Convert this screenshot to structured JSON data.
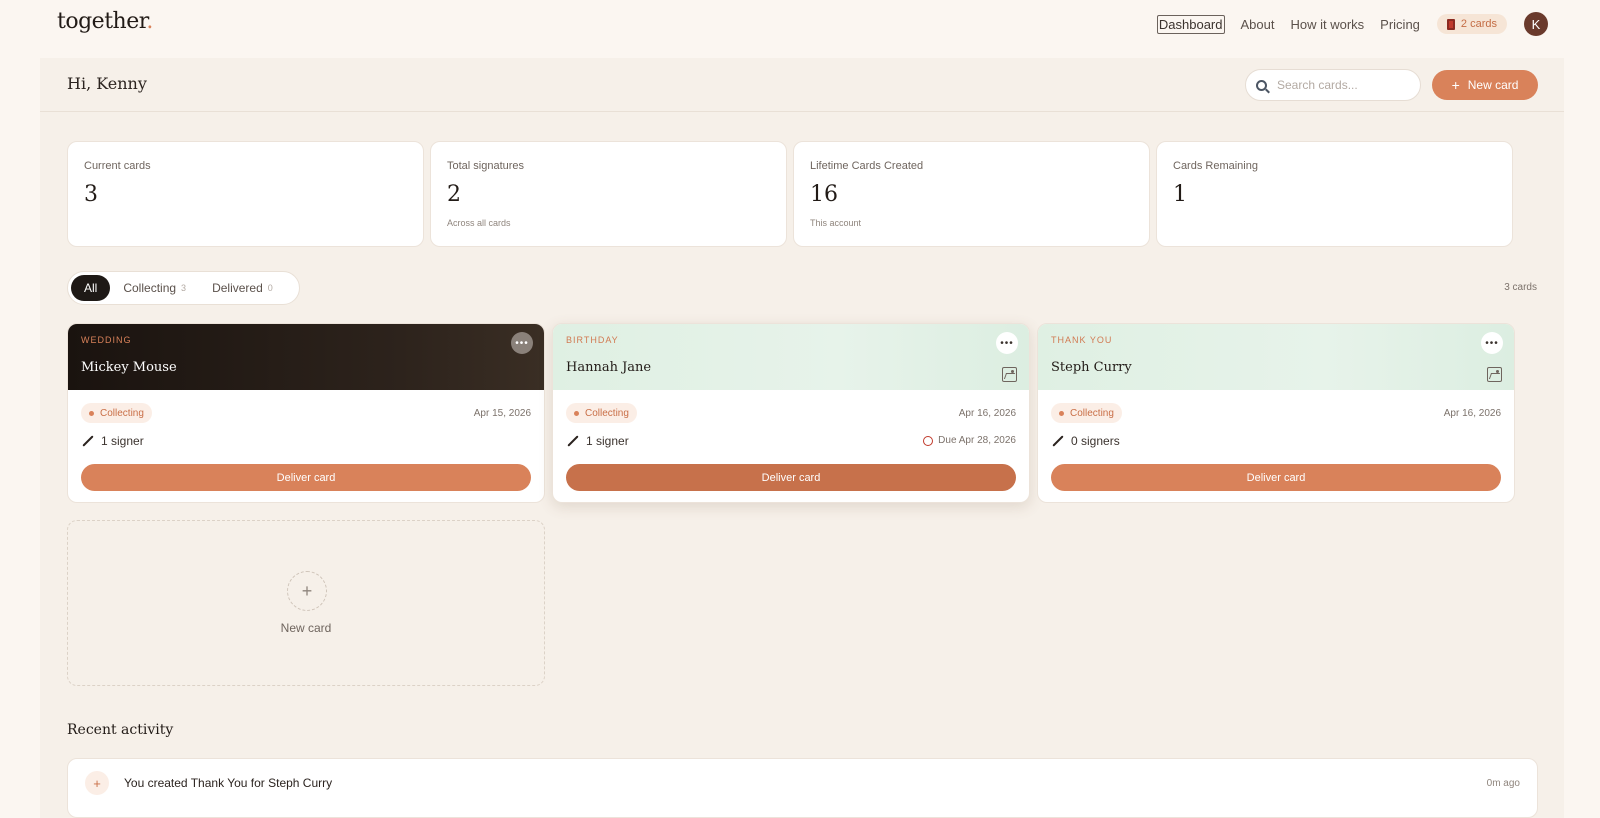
{
  "nav": {
    "logo": "together",
    "logo_dot": ".",
    "links": [
      "Dashboard",
      "About",
      "How it works",
      "Pricing"
    ],
    "credits": "2 cards",
    "avatar_initial": "K"
  },
  "header": {
    "greeting": "Hi, Kenny",
    "search_placeholder": "Search cards...",
    "new_card_label": "New card"
  },
  "stats": [
    {
      "label": "Current cards",
      "value": "3",
      "sub": ""
    },
    {
      "label": "Total signatures",
      "value": "2",
      "sub": "Across all cards"
    },
    {
      "label": "Lifetime Cards Created",
      "value": "16",
      "sub": "This account"
    },
    {
      "label": "Cards Remaining",
      "value": "1",
      "sub": ""
    }
  ],
  "filters": [
    {
      "label": "All",
      "count": ""
    },
    {
      "label": "Collecting",
      "count": "3"
    },
    {
      "label": "Delivered",
      "count": "0"
    }
  ],
  "cards_count": "3 cards",
  "cards": [
    {
      "type": "WEDDING",
      "name": "Mickey Mouse",
      "status": "Collecting",
      "date": "Apr 15, 2026",
      "signers": "1 signer",
      "due": "",
      "action": "Deliver card"
    },
    {
      "type": "BIRTHDAY",
      "name": "Hannah Jane",
      "status": "Collecting",
      "date": "Apr 16, 2026",
      "signers": "1 signer",
      "due": "Due Apr 28, 2026",
      "action": "Deliver card"
    },
    {
      "type": "THANK YOU",
      "name": "Steph Curry",
      "status": "Collecting",
      "date": "Apr 16, 2026",
      "signers": "0 signers",
      "due": "",
      "action": "Deliver card"
    }
  ],
  "new_card_tile": {
    "icon": "+",
    "label": "New card"
  },
  "activity": {
    "title": "Recent activity",
    "items": [
      {
        "icon": "+",
        "text": "You created Thank You for Steph Curry",
        "time": "0m ago"
      }
    ]
  },
  "colors": {
    "accent": "#d9825a",
    "dark": "#1e1916",
    "mint": "#dff0e3"
  }
}
